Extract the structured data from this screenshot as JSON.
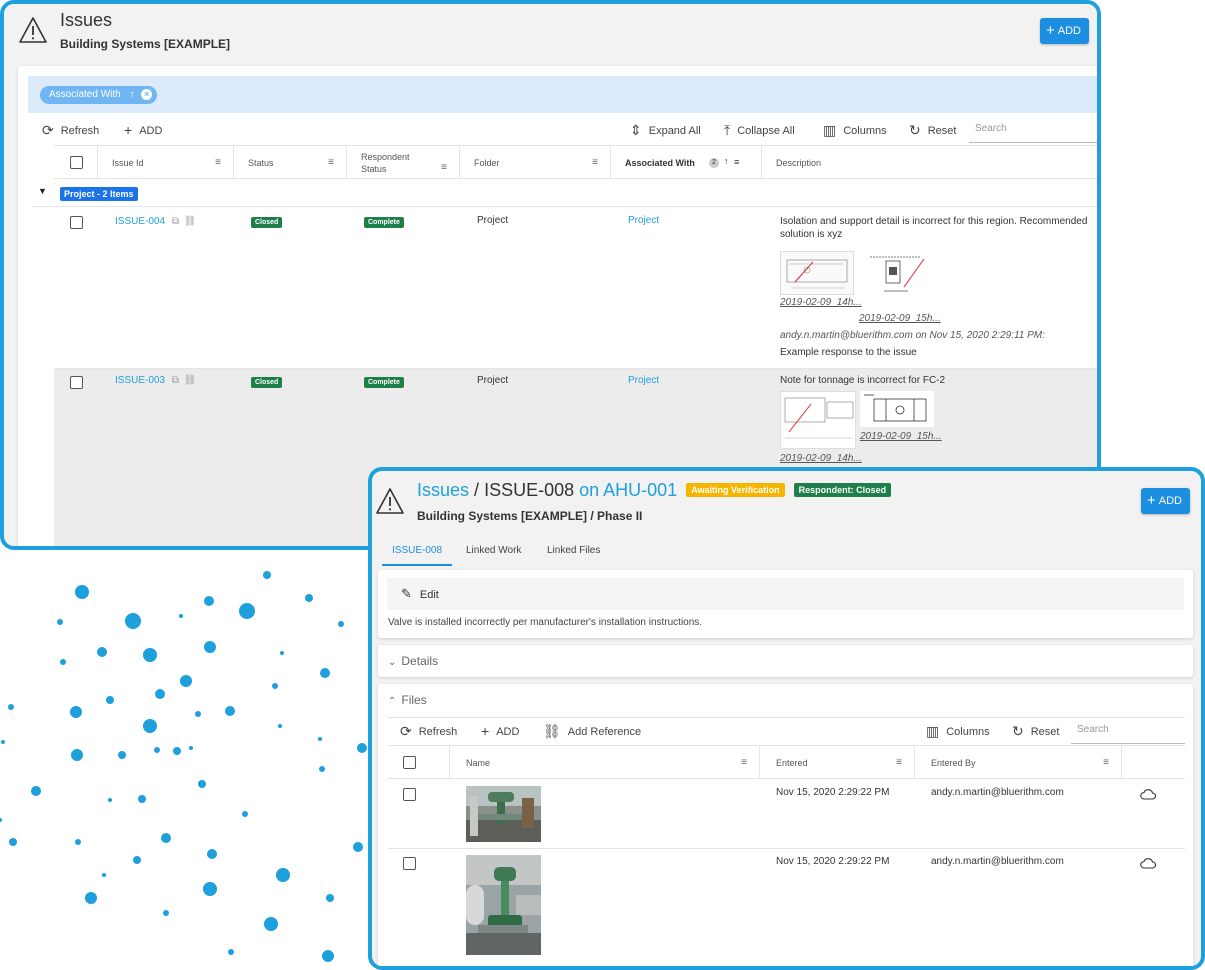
{
  "main_window": {
    "title": "Issues",
    "subtitle": "Building Systems [EXAMPLE]",
    "add_label": "ADD",
    "group_chip": "Associated With",
    "toolbar": {
      "refresh": "Refresh",
      "add": "ADD",
      "expand_all": "Expand All",
      "collapse_all": "Collapse All",
      "columns": "Columns",
      "reset": "Reset",
      "search_placeholder": "Search"
    },
    "columns": {
      "issue_id": "Issue Id",
      "status": "Status",
      "respondent_status_1": "Respondent",
      "respondent_status_2": "Status",
      "folder": "Folder",
      "associated_with": "Associated With",
      "associated_with_rank": "2",
      "description": "Description"
    },
    "group_label": "Project - 2 Items",
    "rows": [
      {
        "id": "ISSUE-004",
        "status": "Closed",
        "respondent_status": "Complete",
        "folder": "Project",
        "associated_with": "Project",
        "description_1": "Isolation and support detail is incorrect for this region. Recommended",
        "description_2": "solution is xyz",
        "file_1": "2019-02-09_14h...",
        "file_2": "2019-02-09_15h...",
        "response_meta": "andy.n.martin@bluerithm.com on Nov 15, 2020 2:29:11 PM:",
        "response_text": "Example response to the issue"
      },
      {
        "id": "ISSUE-003",
        "status": "Closed",
        "respondent_status": "Complete",
        "folder": "Project",
        "associated_with": "Project",
        "description_1": "Note for tonnage is incorrect for FC-2",
        "file_1": "2019-02-09_15h...",
        "file_2": "2019-02-09_14h..."
      }
    ]
  },
  "detail_window": {
    "crumb_root": "Issues",
    "crumb_sep": "/",
    "issue_id": "ISSUE-008",
    "on_label": "on AHU-001",
    "tag_verification": "Awaiting Verification",
    "tag_respondent": "Respondent: Closed",
    "subtitle": "Building Systems [EXAMPLE] / Phase II",
    "add_label": "ADD",
    "tabs": [
      "ISSUE-008",
      "Linked Work",
      "Linked Files"
    ],
    "edit_label": "Edit",
    "description": "Valve is installed incorrectly per manufacturer's installation instructions.",
    "details_label": "Details",
    "files_label": "Files",
    "files_toolbar": {
      "refresh": "Refresh",
      "add": "ADD",
      "add_reference": "Add Reference",
      "columns": "Columns",
      "reset": "Reset",
      "search_placeholder": "Search"
    },
    "files_columns": {
      "name": "Name",
      "entered": "Entered",
      "entered_by": "Entered By"
    },
    "files": [
      {
        "entered": "Nov 15, 2020 2:29:22 PM",
        "entered_by": "andy.n.martin@bluerithm.com"
      },
      {
        "entered": "Nov 15, 2020 2:29:22 PM",
        "entered_by": "andy.n.martin@bluerithm.com"
      }
    ]
  },
  "colors": {
    "accent": "#1ea0dc",
    "button": "#1d8fe1",
    "success_badge": "#1e7f4a",
    "warning_tag": "#f7b500",
    "group_chip": "#1a73e8"
  },
  "icons": [
    "warning-triangle-icon",
    "plus-icon",
    "refresh-icon",
    "expand-icon",
    "collapse-icon",
    "columns-icon",
    "reset-icon",
    "filter-icon",
    "sort-up-icon",
    "open-external-icon",
    "link-icon",
    "pencil-icon",
    "chevron-down-icon",
    "chevron-up-icon",
    "add-reference-icon",
    "cloud-icon",
    "close-circle-icon"
  ]
}
